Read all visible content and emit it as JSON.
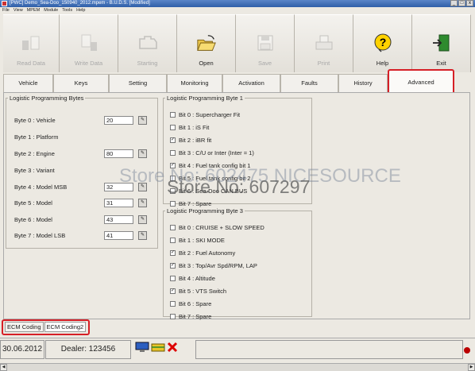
{
  "window": {
    "title": "[PWC] Demo_Sea-Doo_150940_2012.mpem - B.U.D.S. [Modified]",
    "controls": [
      "_",
      "□",
      "x"
    ]
  },
  "menu": [
    "File",
    "View",
    "MPEM",
    "Module",
    "Tools",
    "Help"
  ],
  "toolbar": {
    "read_data": "Read Data",
    "write_data": "Write Data",
    "starting": "Starting",
    "open": "Open",
    "save": "Save",
    "print": "Print",
    "help": "Help",
    "exit": "Exit"
  },
  "tabs": [
    "Vehicle",
    "Keys",
    "Setting",
    "Monitoring",
    "Activation",
    "Faults",
    "History",
    "Advanced"
  ],
  "logistic_bytes": {
    "title": "Logistic Programming Bytes",
    "rows": [
      {
        "label": "Byte 0 : Vehicle",
        "value": "20"
      },
      {
        "label": "Byte 1 : Platform",
        "value": null
      },
      {
        "label": "Byte 2 : Engine",
        "value": "80"
      },
      {
        "label": "Byte 3 : Variant",
        "value": null
      },
      {
        "label": "Byte 4 : Model MSB",
        "value": "32"
      },
      {
        "label": "Byte 5 : Model",
        "value": "31"
      },
      {
        "label": "Byte 6 : Model",
        "value": "43"
      },
      {
        "label": "Byte 7 : Model LSB",
        "value": "41"
      }
    ]
  },
  "byte1": {
    "title": "Logistic Programming Byte 1",
    "bits": [
      {
        "label": "Bit 0 : Supercharger Fit",
        "checked": false
      },
      {
        "label": "Bit 1 : iS Fit",
        "checked": false
      },
      {
        "label": "Bit 2 : iBR fit",
        "checked": true
      },
      {
        "label": "Bit 3 : C/U or Inter (Inter = 1)",
        "checked": false
      },
      {
        "label": "Bit 4 : Fuel tank config bit 1",
        "checked": true
      },
      {
        "label": "Bit 5 : Fuel tank config bit 2",
        "checked": false
      },
      {
        "label": "Bit 6 : Sea-Doo CAN BUS",
        "checked": false
      },
      {
        "label": "Bit 7 : Spare",
        "checked": false
      }
    ]
  },
  "byte3": {
    "title": "Logistic Programming Byte 3",
    "bits": [
      {
        "label": "Bit 0 : CRUISE + SLOW SPEED",
        "checked": false
      },
      {
        "label": "Bit 1 : SKI MODE",
        "checked": false
      },
      {
        "label": "Bit 2 : Fuel Autonomy",
        "checked": true
      },
      {
        "label": "Bit 3 : Top/Avr Spd/RPM, LAP",
        "checked": true
      },
      {
        "label": "Bit 4 : Altitude",
        "checked": false
      },
      {
        "label": "Bit 5 : VTS Switch",
        "checked": true
      },
      {
        "label": "Bit 6 : Spare",
        "checked": false
      },
      {
        "label": "Bit 7 : Spare",
        "checked": false
      }
    ]
  },
  "watermark": {
    "line1": "Store No: 602475 NICESOURCE",
    "line2": "Store No: 607297"
  },
  "bottom_tabs": [
    "ECM Coding",
    "ECM Coding2"
  ],
  "status": {
    "date": "30.06.2012",
    "dealer": "Dealer: 123456"
  },
  "colors": {
    "highlight": "#d61f26",
    "title_bar": "#3a67b0",
    "disabled_text": "#a8a8a8"
  },
  "icons": {
    "read_data": "memory-chip-icon",
    "write_data": "write-document-icon",
    "starting": "engine-icon",
    "open": "open-folder-icon",
    "save": "floppy-disk-icon",
    "print": "printer-icon",
    "help": "help-question-icon",
    "exit": "exit-door-icon"
  }
}
